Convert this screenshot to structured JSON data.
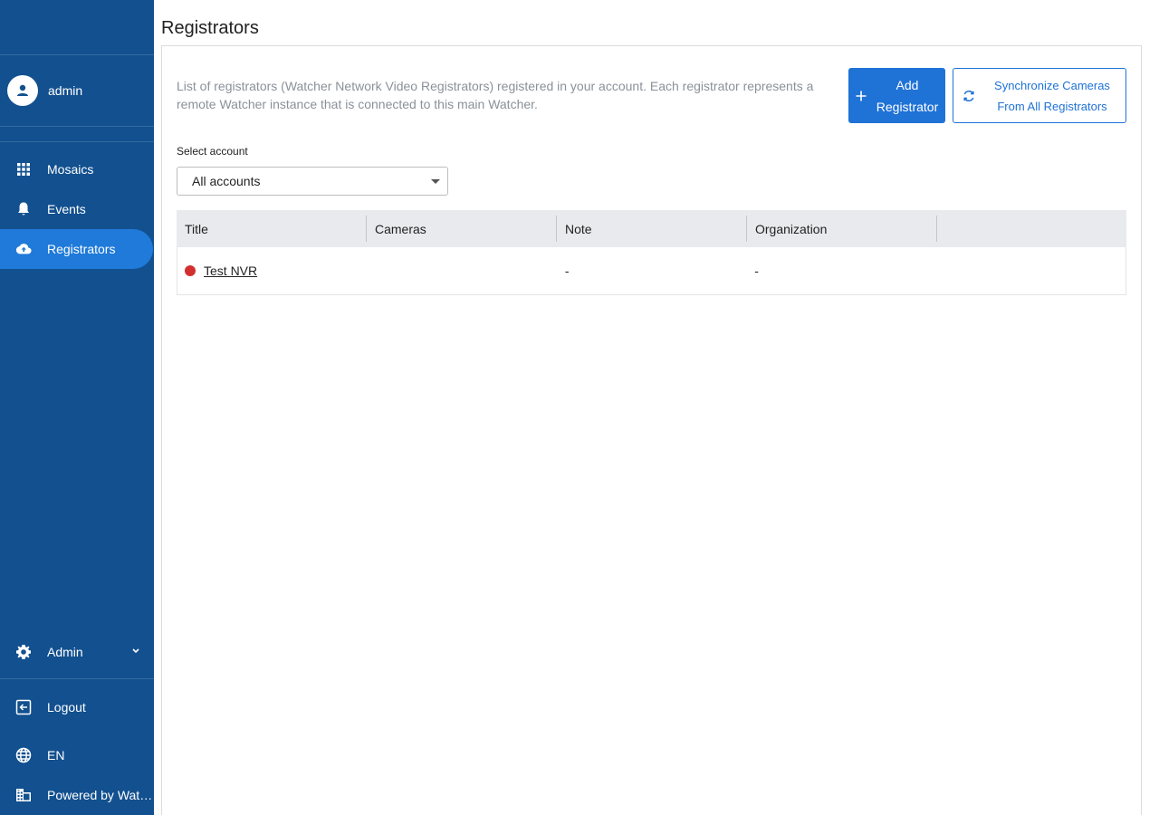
{
  "sidebar": {
    "user": {
      "name": "admin",
      "icon": "user-avatar-icon"
    },
    "items": [
      {
        "label": "Mosaics",
        "icon": "grid-icon"
      },
      {
        "label": "Events",
        "icon": "bell-icon"
      },
      {
        "label": "Registrators",
        "icon": "cloud-upload-icon",
        "active": true
      }
    ],
    "admin": {
      "label": "Admin",
      "icon": "gear-icon"
    },
    "logout": {
      "label": "Logout",
      "icon": "logout-icon"
    },
    "language": {
      "label": "EN",
      "icon": "globe-icon"
    },
    "powered": {
      "label": "Powered by Watcher",
      "icon": "building-icon"
    },
    "colors": {
      "background": "#12508f",
      "active": "#1f7ad9"
    }
  },
  "page": {
    "title": "Registrators",
    "description": "List of registrators (Watcher Network Video Registrators) registered in your account. Each registrator represents a remote Watcher instance that is connected to this main Watcher.",
    "add_button": {
      "line1": "Add",
      "line2": "Registrator",
      "icon": "plus-icon"
    },
    "sync_button": {
      "line1": "Synchronize Cameras",
      "line2": "From All Registrators",
      "icon": "sync-icon"
    },
    "accent": "#1f72d6"
  },
  "account_select": {
    "label": "Select account",
    "value": "All accounts"
  },
  "table": {
    "columns": [
      "Title",
      "Cameras",
      "Note",
      "Organization",
      ""
    ],
    "rows": [
      {
        "status": "offline",
        "status_color": "#d32f2f",
        "title": "Test NVR",
        "cameras": "",
        "note": "-",
        "organization": "-"
      }
    ]
  }
}
